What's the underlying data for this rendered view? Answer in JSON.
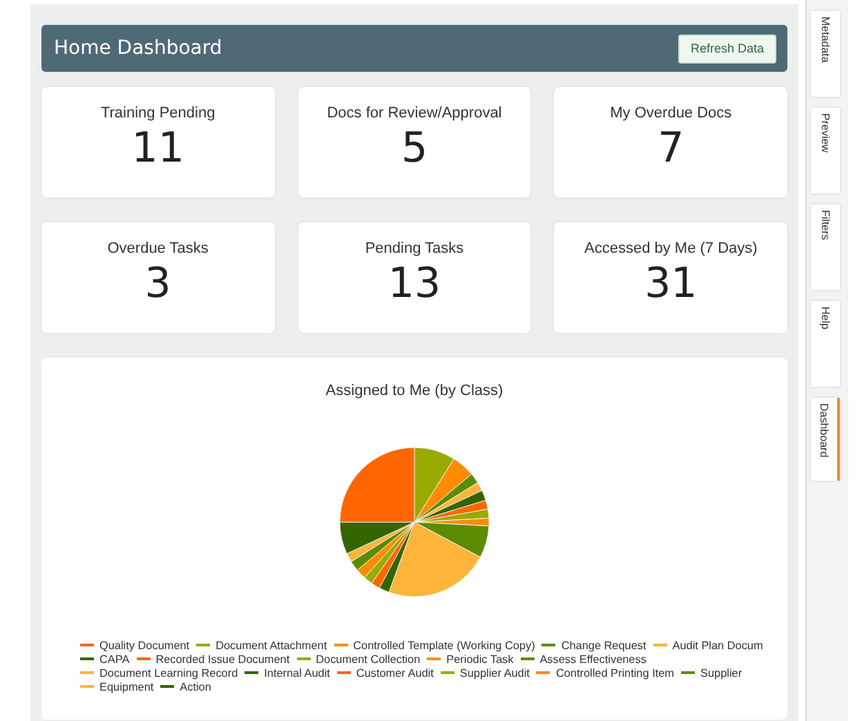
{
  "header": {
    "title": "Home Dashboard",
    "button": "Refresh Data"
  },
  "stats": [
    {
      "label": "Training Pending",
      "value": "11"
    },
    {
      "label": "Docs for Review/Approval",
      "value": "5"
    },
    {
      "label": "My Overdue Docs",
      "value": "7"
    },
    {
      "label": "Overdue Tasks",
      "value": "3"
    },
    {
      "label": "Pending Tasks",
      "value": "13"
    },
    {
      "label": "Accessed by Me (7 Days)",
      "value": "31"
    }
  ],
  "chart": {
    "title": "Assigned to Me (by Class)",
    "legend": [
      {
        "label": "Quality Document",
        "color": "#ff6600"
      },
      {
        "label": "Document Attachment",
        "color": "#99aa00"
      },
      {
        "label": "Controlled Template (Working Copy)",
        "color": "#ff8c00"
      },
      {
        "label": "Change Request",
        "color": "#5b8c00"
      },
      {
        "label": "Audit Plan Docum",
        "color": "#ffb43c"
      },
      {
        "label": "CAPA",
        "color": "#336600"
      },
      {
        "label": "Recorded Issue Document",
        "color": "#ff6600"
      },
      {
        "label": "Document Collection",
        "color": "#99aa00"
      },
      {
        "label": "Periodic Task",
        "color": "#ff8c00"
      },
      {
        "label": "Assess Effectiveness",
        "color": "#5b8c00"
      },
      {
        "label": "Document Learning Record",
        "color": "#ffb43c"
      },
      {
        "label": "Internal Audit",
        "color": "#336600"
      },
      {
        "label": "Customer Audit",
        "color": "#ff6600"
      },
      {
        "label": "Supplier Audit",
        "color": "#99aa00"
      },
      {
        "label": "Controlled Printing Item",
        "color": "#ff8c00"
      },
      {
        "label": "Supplier",
        "color": "#5b8c00"
      },
      {
        "label": "Equipment",
        "color": "#ffb43c"
      },
      {
        "label": "Action",
        "color": "#336600"
      }
    ]
  },
  "side_tabs": [
    {
      "label": "Metadata",
      "selected": false
    },
    {
      "label": "Preview",
      "selected": false
    },
    {
      "label": "Filters",
      "selected": false
    },
    {
      "label": "Help",
      "selected": false
    },
    {
      "label": "Dashboard",
      "selected": true
    }
  ]
}
